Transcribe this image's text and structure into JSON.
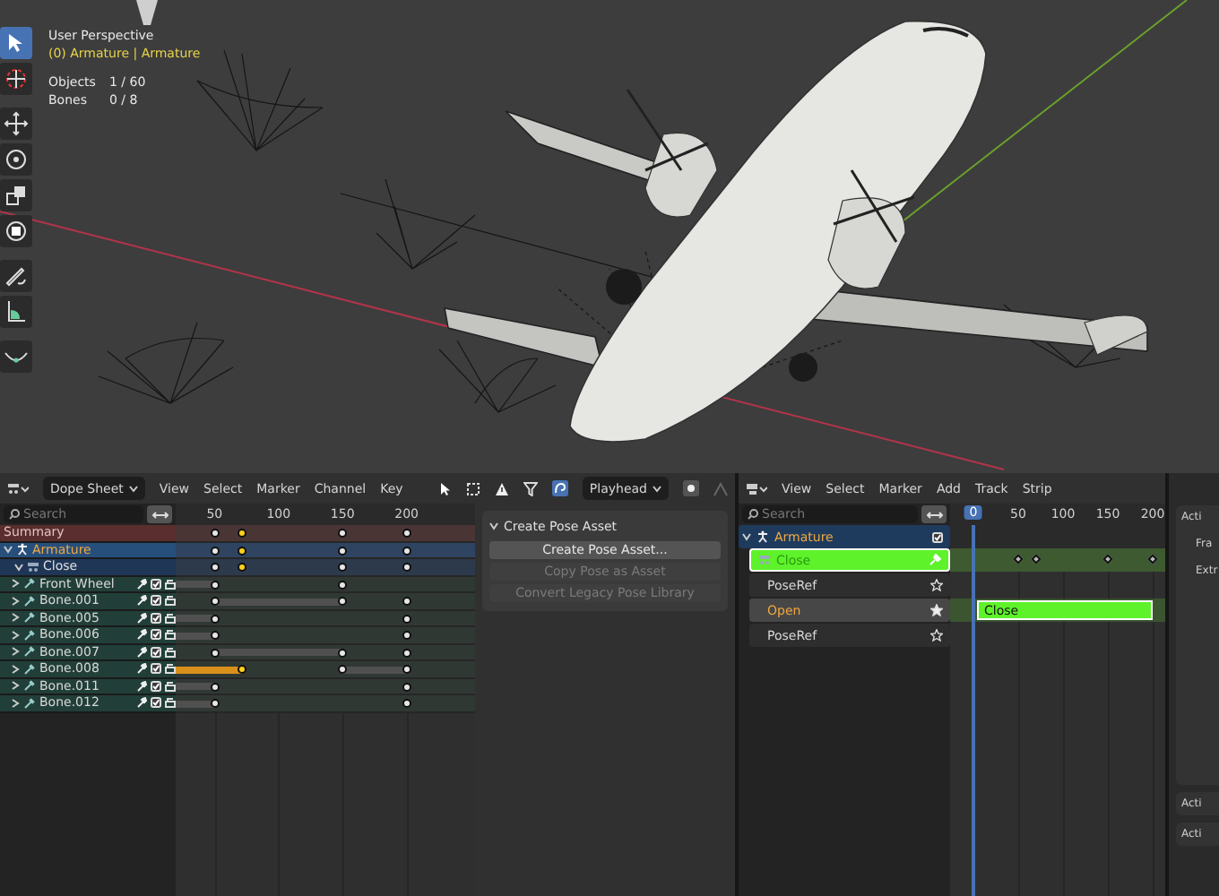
{
  "viewport": {
    "view_name": "User Perspective",
    "context": "(0) Armature | Armature",
    "stats": [
      {
        "label": "Objects",
        "value": "1 / 60"
      },
      {
        "label": "Bones",
        "value": "0 / 8"
      }
    ],
    "tools": [
      {
        "kind": "select",
        "selected": true
      },
      {
        "kind": "cursor",
        "selected": false
      },
      {
        "kind": "move",
        "selected": false
      },
      {
        "kind": "rotate",
        "selected": false
      },
      {
        "kind": "scale",
        "selected": false
      },
      {
        "kind": "transform",
        "selected": false
      },
      {
        "kind": "annotate",
        "selected": false
      },
      {
        "kind": "measure",
        "selected": false
      },
      {
        "kind": "curve",
        "selected": false
      }
    ]
  },
  "dope_sheet": {
    "editor": "Dope Sheet",
    "menus": [
      "View",
      "Select",
      "Marker",
      "Channel",
      "Key"
    ],
    "search_placeholder": "Search",
    "snap": "Playhead",
    "ticks": [
      "50",
      "100",
      "150",
      "200"
    ],
    "channels": [
      {
        "name": "Summary",
        "kind": "summary",
        "keys": [
          {
            "selected": false
          },
          {
            "selected": true
          },
          {
            "selected": false
          },
          {
            "selected": false
          }
        ]
      },
      {
        "name": "Armature",
        "kind": "object",
        "keys": [
          {
            "selected": false
          },
          {
            "selected": true
          },
          {
            "selected": false
          },
          {
            "selected": false
          }
        ]
      },
      {
        "name": "Close",
        "kind": "action",
        "keys": [
          {
            "selected": false
          },
          {
            "selected": true
          },
          {
            "selected": false
          },
          {
            "selected": false
          }
        ]
      },
      {
        "name": "Front Wheel",
        "kind": "bone",
        "checked": true,
        "keys": [
          {
            "selected": false
          },
          {
            "selected": false
          }
        ],
        "holds": [
          {
            "selected": false
          }
        ]
      },
      {
        "name": "Bone.001",
        "kind": "bone",
        "checked": true,
        "keys": [
          {
            "selected": false
          },
          {
            "selected": false
          },
          {
            "selected": false
          }
        ],
        "holds": [
          {
            "selected": false
          }
        ]
      },
      {
        "name": "Bone.005",
        "kind": "bone",
        "checked": true,
        "keys": [
          {
            "selected": false
          },
          {
            "selected": false
          }
        ],
        "holds": [
          {
            "selected": false
          }
        ]
      },
      {
        "name": "Bone.006",
        "kind": "bone",
        "checked": true,
        "keys": [
          {
            "selected": false
          },
          {
            "selected": false
          }
        ],
        "holds": [
          {
            "selected": false
          }
        ]
      },
      {
        "name": "Bone.007",
        "kind": "bone",
        "checked": true,
        "keys": [
          {
            "selected": false
          },
          {
            "selected": false
          },
          {
            "selected": false
          }
        ],
        "holds": [
          {
            "selected": false
          }
        ]
      },
      {
        "name": "Bone.008",
        "kind": "bone",
        "checked": true,
        "keys": [
          {
            "selected": true
          },
          {
            "selected": false
          },
          {
            "selected": false
          }
        ],
        "holds": [
          {
            "selected": true
          },
          {
            "selected": false
          }
        ]
      },
      {
        "name": "Bone.011",
        "kind": "bone",
        "checked": true,
        "keys": [
          {
            "selected": false
          },
          {
            "selected": false
          }
        ],
        "holds": [
          {
            "selected": false
          }
        ]
      },
      {
        "name": "Bone.012",
        "kind": "bone",
        "checked": true,
        "keys": [
          {
            "selected": false
          },
          {
            "selected": false
          }
        ],
        "holds": [
          {
            "selected": false
          }
        ]
      }
    ]
  },
  "pose_panel": {
    "title": "Create Pose Asset",
    "expanded": true,
    "buttons": [
      {
        "label": "Create Pose Asset...",
        "disabled": false
      },
      {
        "label": "Copy Pose as Asset",
        "disabled": true
      },
      {
        "label": "Convert Legacy Pose Library",
        "disabled": true
      }
    ]
  },
  "nla": {
    "menus": [
      "View",
      "Select",
      "Marker",
      "Add",
      "Track",
      "Strip"
    ],
    "search_placeholder": "Search",
    "current_frame": "0",
    "ticks": [
      "50",
      "100",
      "150",
      "200"
    ],
    "tracks": [
      {
        "name": "Armature",
        "kind": "object",
        "checked": true
      },
      {
        "name": "Close",
        "kind": "action"
      },
      {
        "name": "PoseRef",
        "kind": "track",
        "selected": false,
        "starred": false
      },
      {
        "name": "Open",
        "kind": "track",
        "selected": true,
        "starred": true,
        "strip": {
          "label": "Close"
        }
      },
      {
        "name": "PoseRef",
        "kind": "track",
        "selected": false,
        "starred": false
      }
    ]
  },
  "sidebar": {
    "panel_title": "Acti",
    "fields": [
      "Fra",
      "Extr"
    ],
    "collapsed_panels": [
      "Acti",
      "Acti"
    ]
  }
}
